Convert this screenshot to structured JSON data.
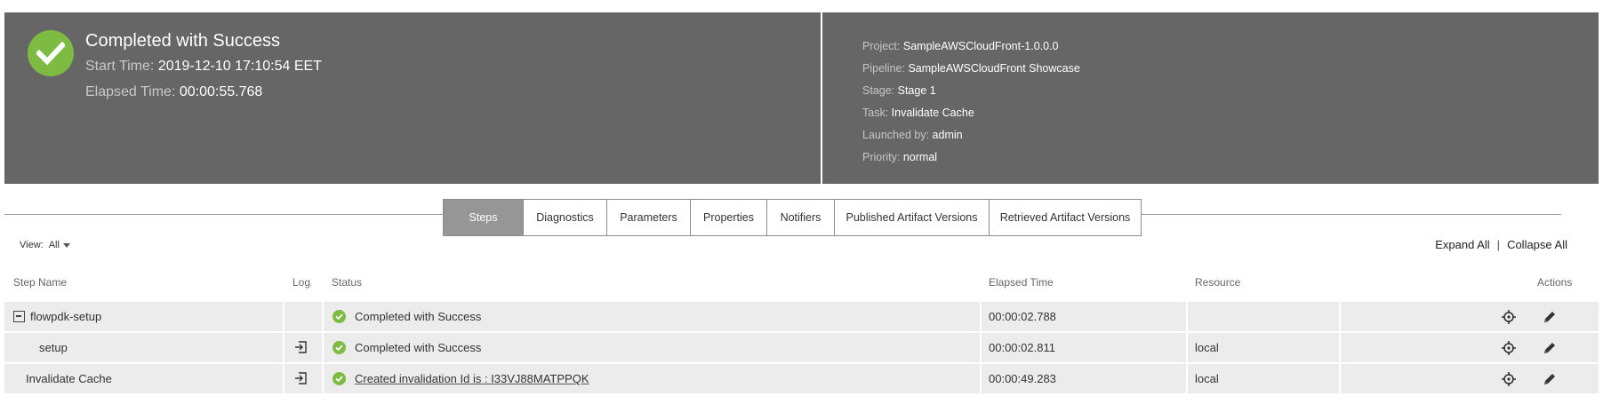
{
  "summary": {
    "title": "Completed with Success",
    "start_label": "Start Time:",
    "start_value": "2019-12-10 17:10:54 EET",
    "elapsed_label": "Elapsed Time:",
    "elapsed_value": "00:00:55.768",
    "status_icon": "check-circle-icon",
    "status_color": "#7dbb42"
  },
  "meta": [
    {
      "label": "Project:",
      "value": "SampleAWSCloudFront-1.0.0.0"
    },
    {
      "label": "Pipeline:",
      "value": "SampleAWSCloudFront Showcase"
    },
    {
      "label": "Stage:",
      "value": "Stage 1"
    },
    {
      "label": "Task:",
      "value": "Invalidate Cache"
    },
    {
      "label": "Launched by:",
      "value": "admin"
    },
    {
      "label": "Priority:",
      "value": "normal"
    }
  ],
  "tabs": [
    {
      "label": "Steps",
      "active": true
    },
    {
      "label": "Diagnostics",
      "active": false
    },
    {
      "label": "Parameters",
      "active": false
    },
    {
      "label": "Properties",
      "active": false
    },
    {
      "label": "Notifiers",
      "active": false
    },
    {
      "label": "Published Artifact Versions",
      "active": false
    },
    {
      "label": "Retrieved Artifact Versions",
      "active": false
    }
  ],
  "view": {
    "label": "View:",
    "value": "All"
  },
  "expand_all": "Expand All",
  "collapse_all": "Collapse All",
  "columns": {
    "step_name": "Step Name",
    "log": "Log",
    "status": "Status",
    "elapsed": "Elapsed Time",
    "resource": "Resource",
    "actions": "Actions"
  },
  "rows": [
    {
      "name": "flowpdk-setup",
      "has_log": false,
      "status": "Completed with Success",
      "status_link": false,
      "elapsed": "00:00:02.788",
      "resource": "",
      "group": true,
      "indent": 0
    },
    {
      "name": "setup",
      "has_log": true,
      "status": "Completed with Success",
      "status_link": false,
      "elapsed": "00:00:02.811",
      "resource": "local",
      "group": false,
      "indent": 1
    },
    {
      "name": "Invalidate Cache",
      "has_log": true,
      "status": "Created invalidation Id is : I33VJ88MATPPQK",
      "status_link": true,
      "elapsed": "00:00:49.283",
      "resource": "local",
      "group": false,
      "indent": 0
    }
  ]
}
